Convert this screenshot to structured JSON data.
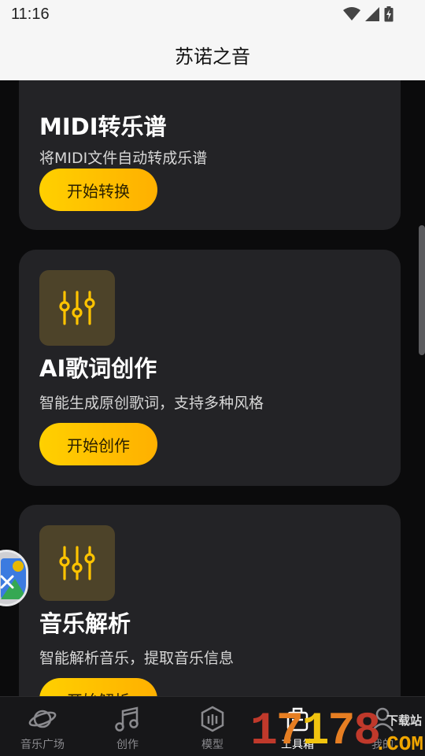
{
  "status_bar": {
    "time": "11:16"
  },
  "header": {
    "title": "苏诺之音"
  },
  "cards": [
    {
      "title": "MIDI转乐谱",
      "description": "将MIDI文件自动转成乐谱",
      "button": "开始转换",
      "icon": "equalizer-sliders-icon"
    },
    {
      "title": "AI歌词创作",
      "description": "智能生成原创歌词，支持多种风格",
      "button": "开始创作",
      "icon": "equalizer-sliders-icon"
    },
    {
      "title": "音乐解析",
      "description": "智能解析音乐，提取音乐信息",
      "button": "开始解析",
      "icon": "equalizer-sliders-icon"
    }
  ],
  "bottom_nav": [
    {
      "label": "音乐广场",
      "icon": "planet-icon",
      "active": false
    },
    {
      "label": "创作",
      "icon": "music-note-icon",
      "active": false
    },
    {
      "label": "模型",
      "icon": "model-cube-icon",
      "active": false
    },
    {
      "label": "工具箱",
      "icon": "toolbox-icon",
      "active": true
    },
    {
      "label": "我的",
      "icon": "user-icon",
      "active": false
    }
  ],
  "watermark": {
    "digits": "17178",
    "site_text": "下载站",
    "suffix": ".COM"
  },
  "colors": {
    "accent": "#ffc400",
    "card_bg": "#232326",
    "page_bg": "#0b0b0c",
    "header_bg": "#f6f6f6"
  }
}
